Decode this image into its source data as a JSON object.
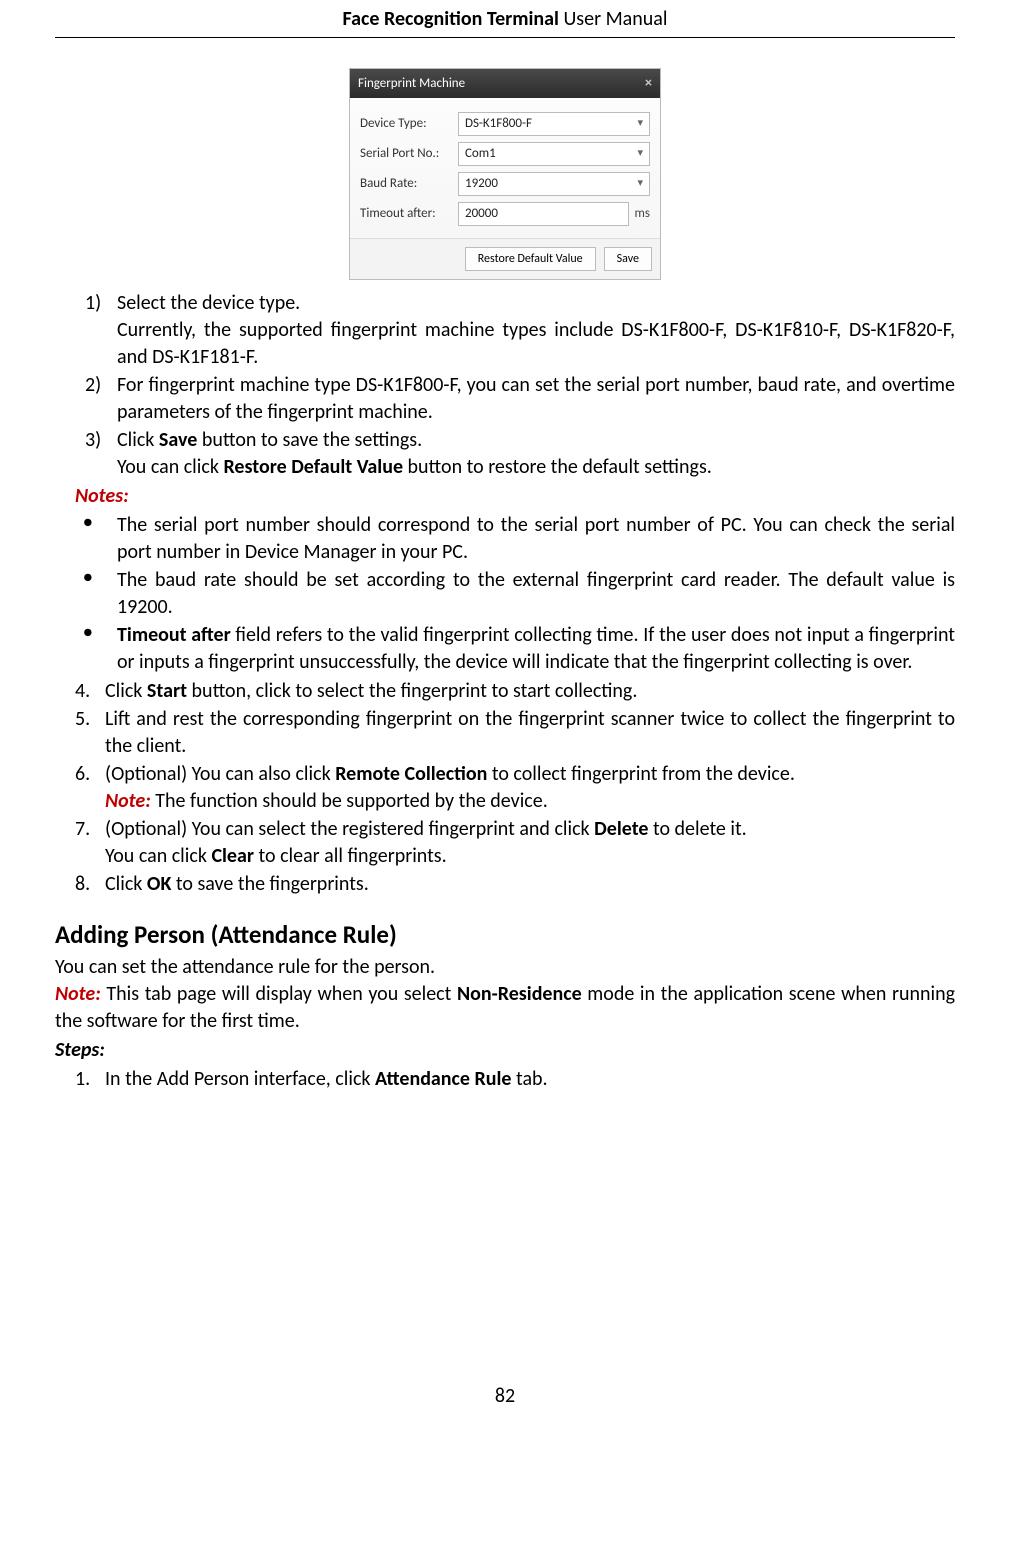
{
  "header": {
    "title_bold": "Face Recognition Terminal",
    "title_rest": "  User Manual"
  },
  "dialog": {
    "title": "Fingerprint Machine",
    "close": "×",
    "label_device_type": "Device Type:",
    "val_device_type": "DS-K1F800-F",
    "label_serial": "Serial Port No.:",
    "val_serial": "Com1",
    "label_baud": "Baud Rate:",
    "val_baud": "19200",
    "label_timeout": "Timeout after:",
    "val_timeout": "20000",
    "unit_ms": "ms",
    "btn_restore": "Restore Default Value",
    "btn_save": "Save"
  },
  "step1_num": "1)",
  "step1_text": "Select the device type.",
  "step1_para": "Currently, the supported fingerprint machine types include DS-K1F800-F, DS-K1F810-F, DS-K1F820-F, and DS-K1F181-F.",
  "step2_num": "2)",
  "step2_text": "For fingerprint machine type DS-K1F800-F, you can set the serial port number, baud rate, and overtime parameters of the fingerprint machine.",
  "step3_num": "3)",
  "step3_a": "Click ",
  "step3_b": "Save",
  "step3_c": " button to save the settings.",
  "step3_sub_a": "You can click ",
  "step3_sub_b": "Restore Default Value",
  "step3_sub_c": " button to restore the default settings.",
  "notes_label": "Notes:",
  "note1": "The serial port number should correspond to the serial port number of PC. You can check the serial port number in Device Manager in your PC.",
  "note2": "The baud rate should be set according to the external fingerprint card reader. The default value is 19200.",
  "note3_a": "Timeout after",
  "note3_b": " field refers to the valid fingerprint collecting time. If the user does not input a fingerprint or inputs a fingerprint unsuccessfully, the device will indicate that the fingerprint collecting is over.",
  "top4_num": "4.",
  "top4_a": "Click ",
  "top4_b": "Start",
  "top4_c": " button, click to select the fingerprint to start collecting.",
  "top5_num": "5.",
  "top5": "Lift and rest the corresponding fingerprint on the fingerprint scanner twice to collect the fingerprint to the client.",
  "top6_num": "6.",
  "top6_a": "(Optional) You can also click ",
  "top6_b": "Remote Collection",
  "top6_c": " to collect fingerprint from the device.",
  "top6_note_label": "Note:",
  "top6_note_text": " The function should be supported by the device.",
  "top7_num": "7.",
  "top7_a": "(Optional) You can select the registered fingerprint and click ",
  "top7_b": "Delete",
  "top7_c": " to delete it.",
  "top7_sub_a": "You can click ",
  "top7_sub_b": "Clear",
  "top7_sub_c": " to clear all fingerprints.",
  "top8_num": "8.",
  "top8_a": "Click ",
  "top8_b": "OK",
  "top8_c": " to save the fingerprints.",
  "section_heading": "Adding Person (Attendance Rule)",
  "section_intro": "You can set the attendance rule for the person.",
  "section_note_label": "Note:",
  "section_note_a": " This tab page will display when you select ",
  "section_note_b": "Non-Residence",
  "section_note_c": " mode in the application scene when running the software for the first time.",
  "steps_label": "Steps:",
  "sec_step1_num": "1.",
  "sec_step1_a": "In the Add Person interface, click ",
  "sec_step1_b": "Attendance Rule",
  "sec_step1_c": " tab.",
  "page_number": "82"
}
